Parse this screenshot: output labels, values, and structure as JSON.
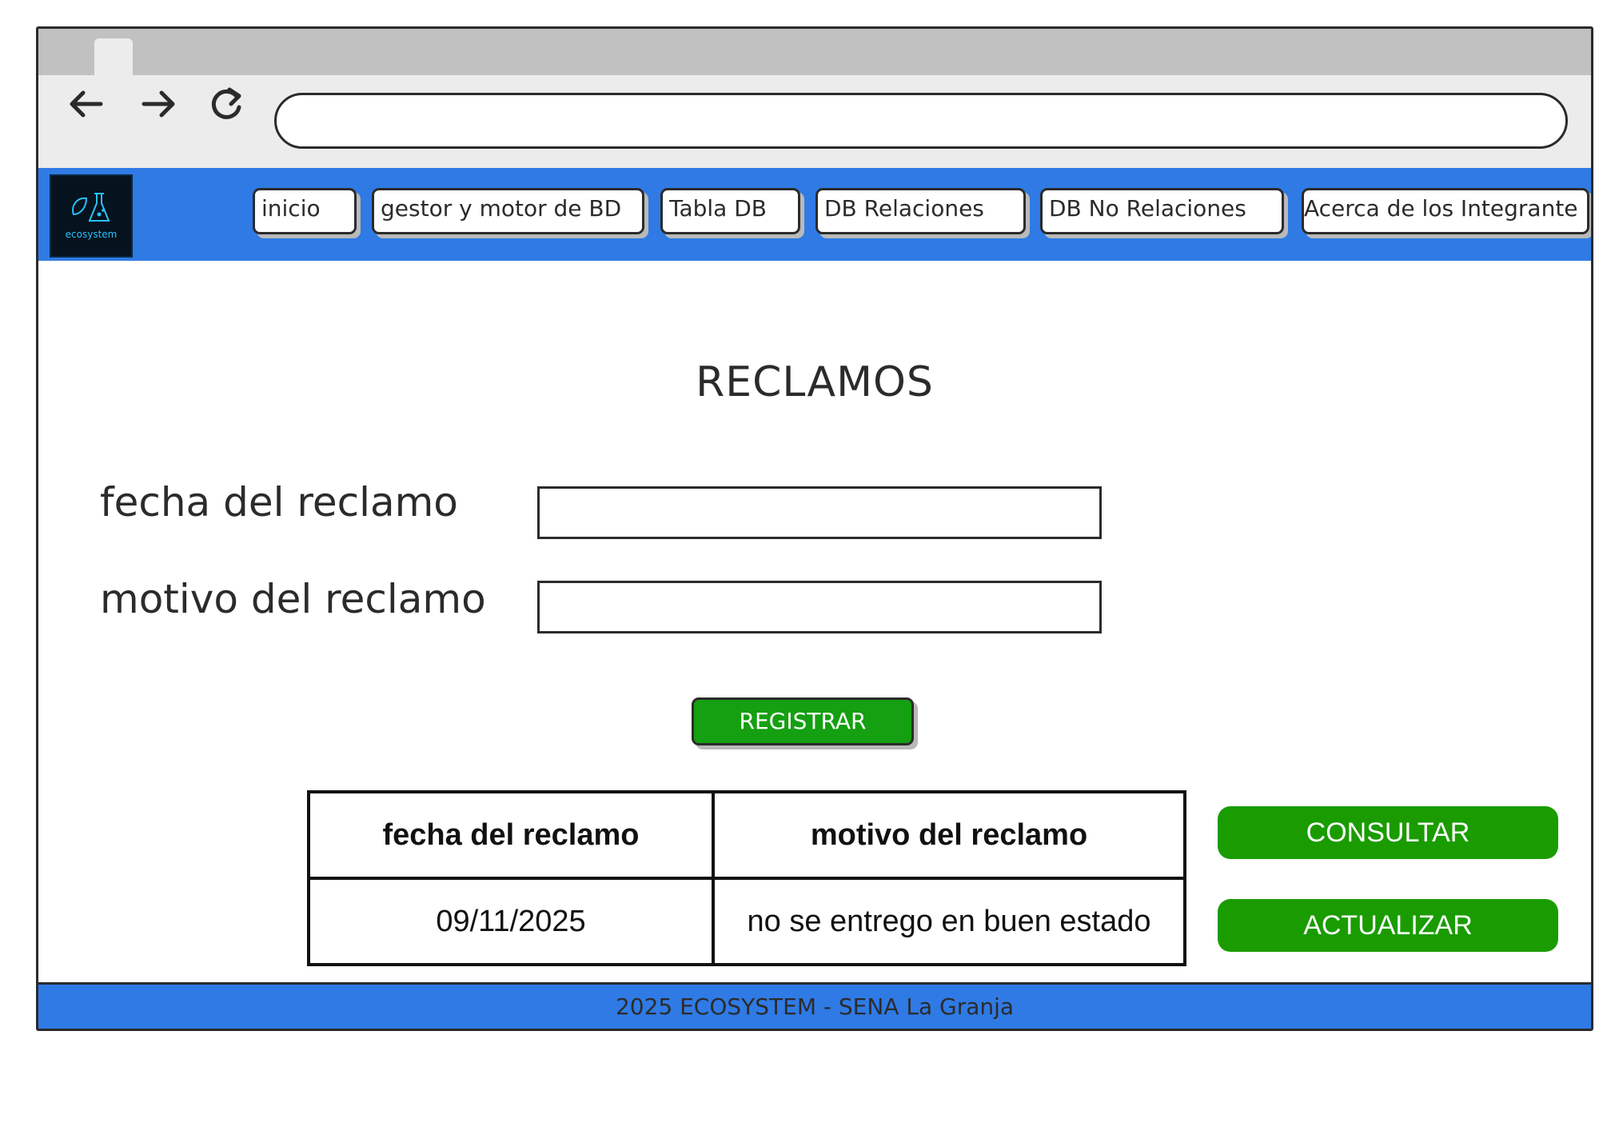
{
  "navbar": {
    "logo_text": "ecosystem",
    "items": [
      {
        "label": "inicio"
      },
      {
        "label": "gestor y motor de BD"
      },
      {
        "label": "Tabla DB"
      },
      {
        "label": "DB Relaciones"
      },
      {
        "label": "DB No Relaciones"
      },
      {
        "label": "Acerca de los Integrante"
      }
    ]
  },
  "page": {
    "title": "RECLAMOS"
  },
  "form": {
    "date_label": "fecha del reclamo",
    "date_value": "",
    "reason_label": "motivo del reclamo",
    "reason_value": "",
    "register_label": "REGISTRAR"
  },
  "table": {
    "headers": [
      "fecha del reclamo",
      "motivo del reclamo"
    ],
    "rows": [
      [
        "09/11/2025",
        "no se entrego en buen estado"
      ]
    ]
  },
  "actions": {
    "consult_label": "CONSULTAR",
    "update_label": "ACTUALIZAR"
  },
  "footer": {
    "text": "2025 ECOSYSTEM - SENA La Granja"
  },
  "colors": {
    "brand_blue": "#2f7ae5",
    "action_green": "#1a9c00",
    "register_green": "#14a010"
  }
}
